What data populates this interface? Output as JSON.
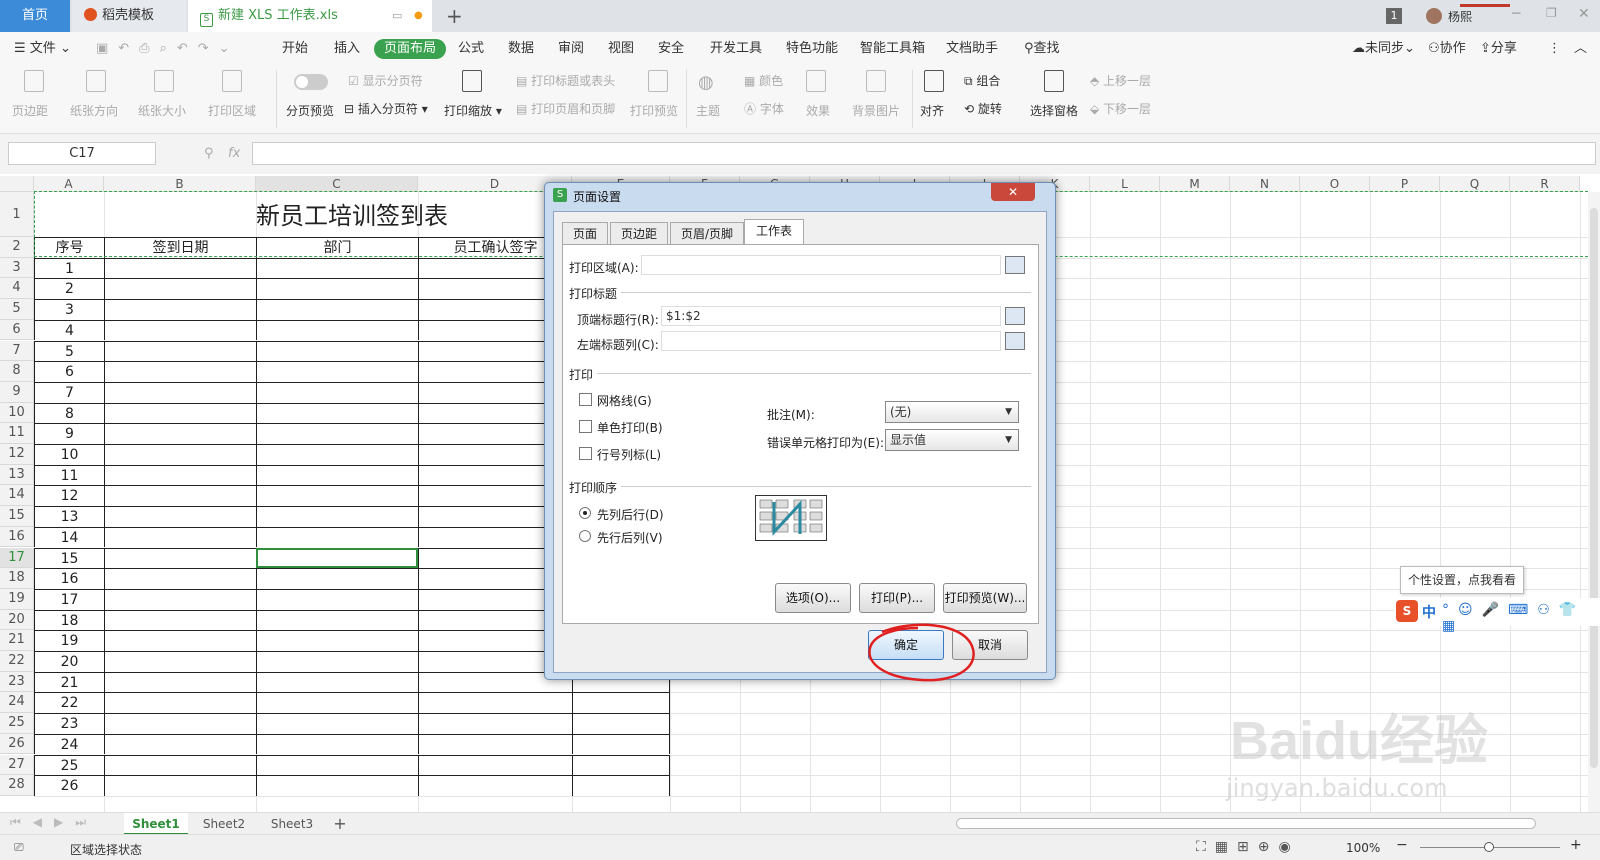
{
  "tabs": {
    "home": "首页",
    "template": "稻壳模板",
    "document": "新建 XLS 工作表.xls",
    "new_tab": "+"
  },
  "titlebar": {
    "notification_count": "1",
    "user": "杨熙"
  },
  "menu": {
    "file": "文件",
    "items": [
      "开始",
      "插入",
      "页面布局",
      "公式",
      "数据",
      "审阅",
      "视图",
      "安全",
      "开发工具",
      "特色功能",
      "智能工具箱",
      "文档助手",
      "查找"
    ],
    "active": "页面布局",
    "sync": "未同步",
    "collab": "协作",
    "share": "分享"
  },
  "ribbon": {
    "margin": "页边距",
    "orientation": "纸张方向",
    "size": "纸张大小",
    "print_area": "打印区域",
    "page_break_preview": "分页预览",
    "show_breaks": "显示分页符",
    "insert_break": "插入分页符",
    "print_scale": "打印缩放",
    "print_titles": "打印标题或表头",
    "header_footer": "打印页眉和页脚",
    "print_preview": "打印预览",
    "theme": "主题",
    "color": "颜色",
    "font": "字体",
    "effect": "效果",
    "background": "背景图片",
    "align": "对齐",
    "group": "组合",
    "rotate": "旋转",
    "selection_pane": "选择窗格",
    "bring_forward": "上移一层",
    "send_backward": "下移一层"
  },
  "formula": {
    "cell_ref": "C17",
    "fx": "fx",
    "value": ""
  },
  "columns": [
    "A",
    "B",
    "C",
    "D",
    "E",
    "F",
    "G",
    "H",
    "I",
    "J",
    "K",
    "L",
    "M",
    "N",
    "O",
    "P",
    "Q",
    "R"
  ],
  "sheet": {
    "title": "新员工培训签到表",
    "headers": [
      "序号",
      "签到日期",
      "部门",
      "员工确认签字"
    ],
    "rows": [
      "1",
      "2",
      "3",
      "4",
      "5",
      "6",
      "7",
      "8",
      "9",
      "10",
      "11",
      "12",
      "13",
      "14",
      "15",
      "16",
      "17",
      "18",
      "19",
      "20",
      "21",
      "22",
      "23",
      "24",
      "25",
      "26"
    ],
    "row_numbers": [
      "1",
      "2",
      "3",
      "4",
      "5",
      "6",
      "7",
      "8",
      "9",
      "10",
      "11",
      "12",
      "13",
      "14",
      "15",
      "16",
      "17",
      "18",
      "19",
      "20",
      "21",
      "22",
      "23",
      "24",
      "25",
      "26",
      "27",
      "28"
    ]
  },
  "sheet_tabs": [
    "Sheet1",
    "Sheet2",
    "Sheet3"
  ],
  "status": {
    "text": "区域选择状态",
    "zoom": "100%"
  },
  "dialog": {
    "title": "页面设置",
    "tabs": [
      "页面",
      "页边距",
      "页眉/页脚",
      "工作表"
    ],
    "active_tab": "工作表",
    "print_area_label": "打印区域(A):",
    "print_area_value": "",
    "print_titles_section": "打印标题",
    "top_rows_label": "顶端标题行(R):",
    "top_rows_value": "$1:$2",
    "left_cols_label": "左端标题列(C):",
    "left_cols_value": "",
    "print_section": "打印",
    "gridlines": "网格线(G)",
    "mono": "单色打印(B)",
    "row_col_headers": "行号列标(L)",
    "comments_label": "批注(M):",
    "comments_value": "(无)",
    "errors_label": "错误单元格打印为(E):",
    "errors_value": "显示值",
    "order_section": "打印顺序",
    "order_down": "先列后行(D)",
    "order_over": "先行后列(V)",
    "order_selected": "先列后行(D)",
    "options_btn": "选项(O)...",
    "print_btn": "打印(P)...",
    "preview_btn": "打印预览(W)...",
    "ok_btn": "确定",
    "cancel_btn": "取消"
  },
  "ime": {
    "tip": "个性设置，点我看看",
    "mode": "中"
  },
  "watermark": {
    "brand": "Baidu经验",
    "url": "jingyan.baidu.com"
  },
  "colors": {
    "accent_green": "#3aa24e",
    "tab_blue": "#3c8bd9",
    "annotation_red": "#e02020"
  }
}
